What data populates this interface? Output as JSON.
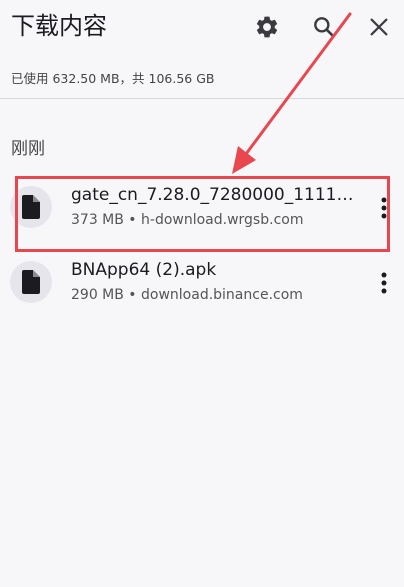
{
  "header": {
    "title": "下载内容",
    "icons": {
      "settings": "gear-icon",
      "search": "search-icon",
      "close": "close-icon"
    }
  },
  "storage": {
    "text": "已使用 632.50 MB，共 106.56 GB"
  },
  "sections": [
    {
      "label": "刚刚",
      "items": [
        {
          "name": "gate_cn_7.28.0_7280000_11111...",
          "meta": "373 MB • h-download.wrgsb.com",
          "icon": "file-icon"
        },
        {
          "name": "BNApp64 (2).apk",
          "meta": "290 MB • download.binance.com",
          "icon": "file-icon"
        }
      ]
    }
  ],
  "colors": {
    "background": "#f7f6f9",
    "annotation": "#e8474f",
    "icon_circle": "#e6e5ec",
    "text_primary": "#1c1b1f"
  }
}
